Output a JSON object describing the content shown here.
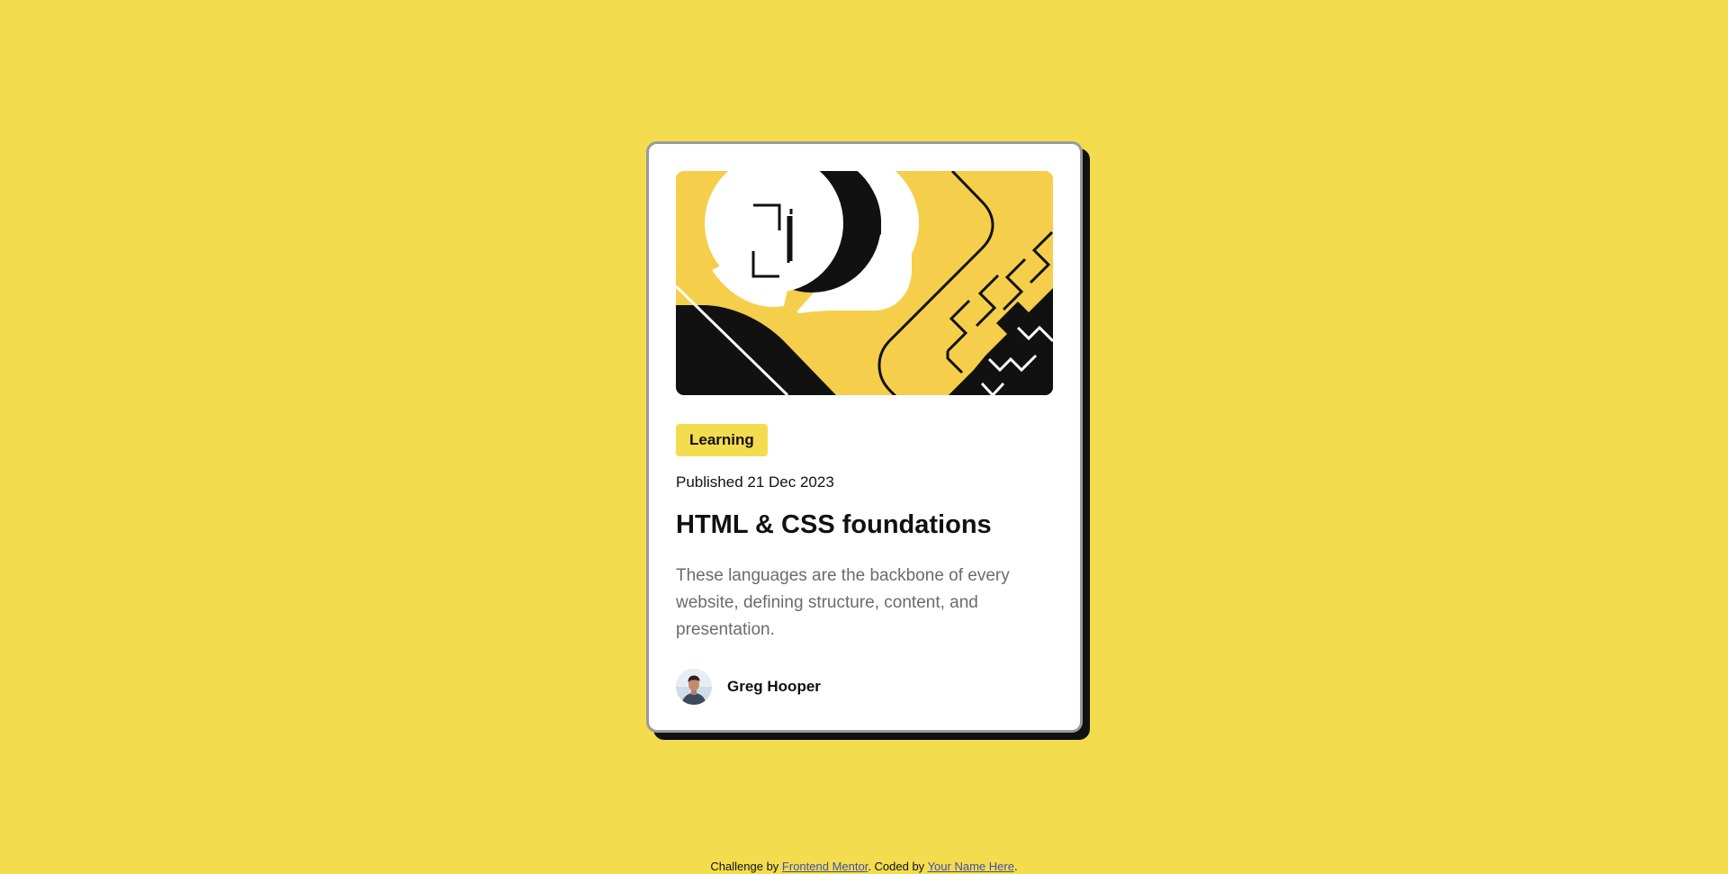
{
  "card": {
    "category": "Learning",
    "published": "Published 21 Dec 2023",
    "title": "HTML & CSS foundations",
    "description": "These languages are the backbone of every website, defining structure, content, and presentation.",
    "author": {
      "name": "Greg Hooper"
    }
  },
  "attribution": {
    "prefix": "Challenge by ",
    "link1": "Frontend Mentor",
    "middle": ". Coded by ",
    "link2": "Your Name Here",
    "suffix": "."
  },
  "colors": {
    "background": "#f4dc4f",
    "accent": "#f4dc4f",
    "illustration_yellow": "#f5ce4b",
    "text_dark": "#111111",
    "text_muted": "#6b6b6b"
  },
  "icons": {
    "hero": "abstract-illustration",
    "avatar": "author-photo"
  }
}
